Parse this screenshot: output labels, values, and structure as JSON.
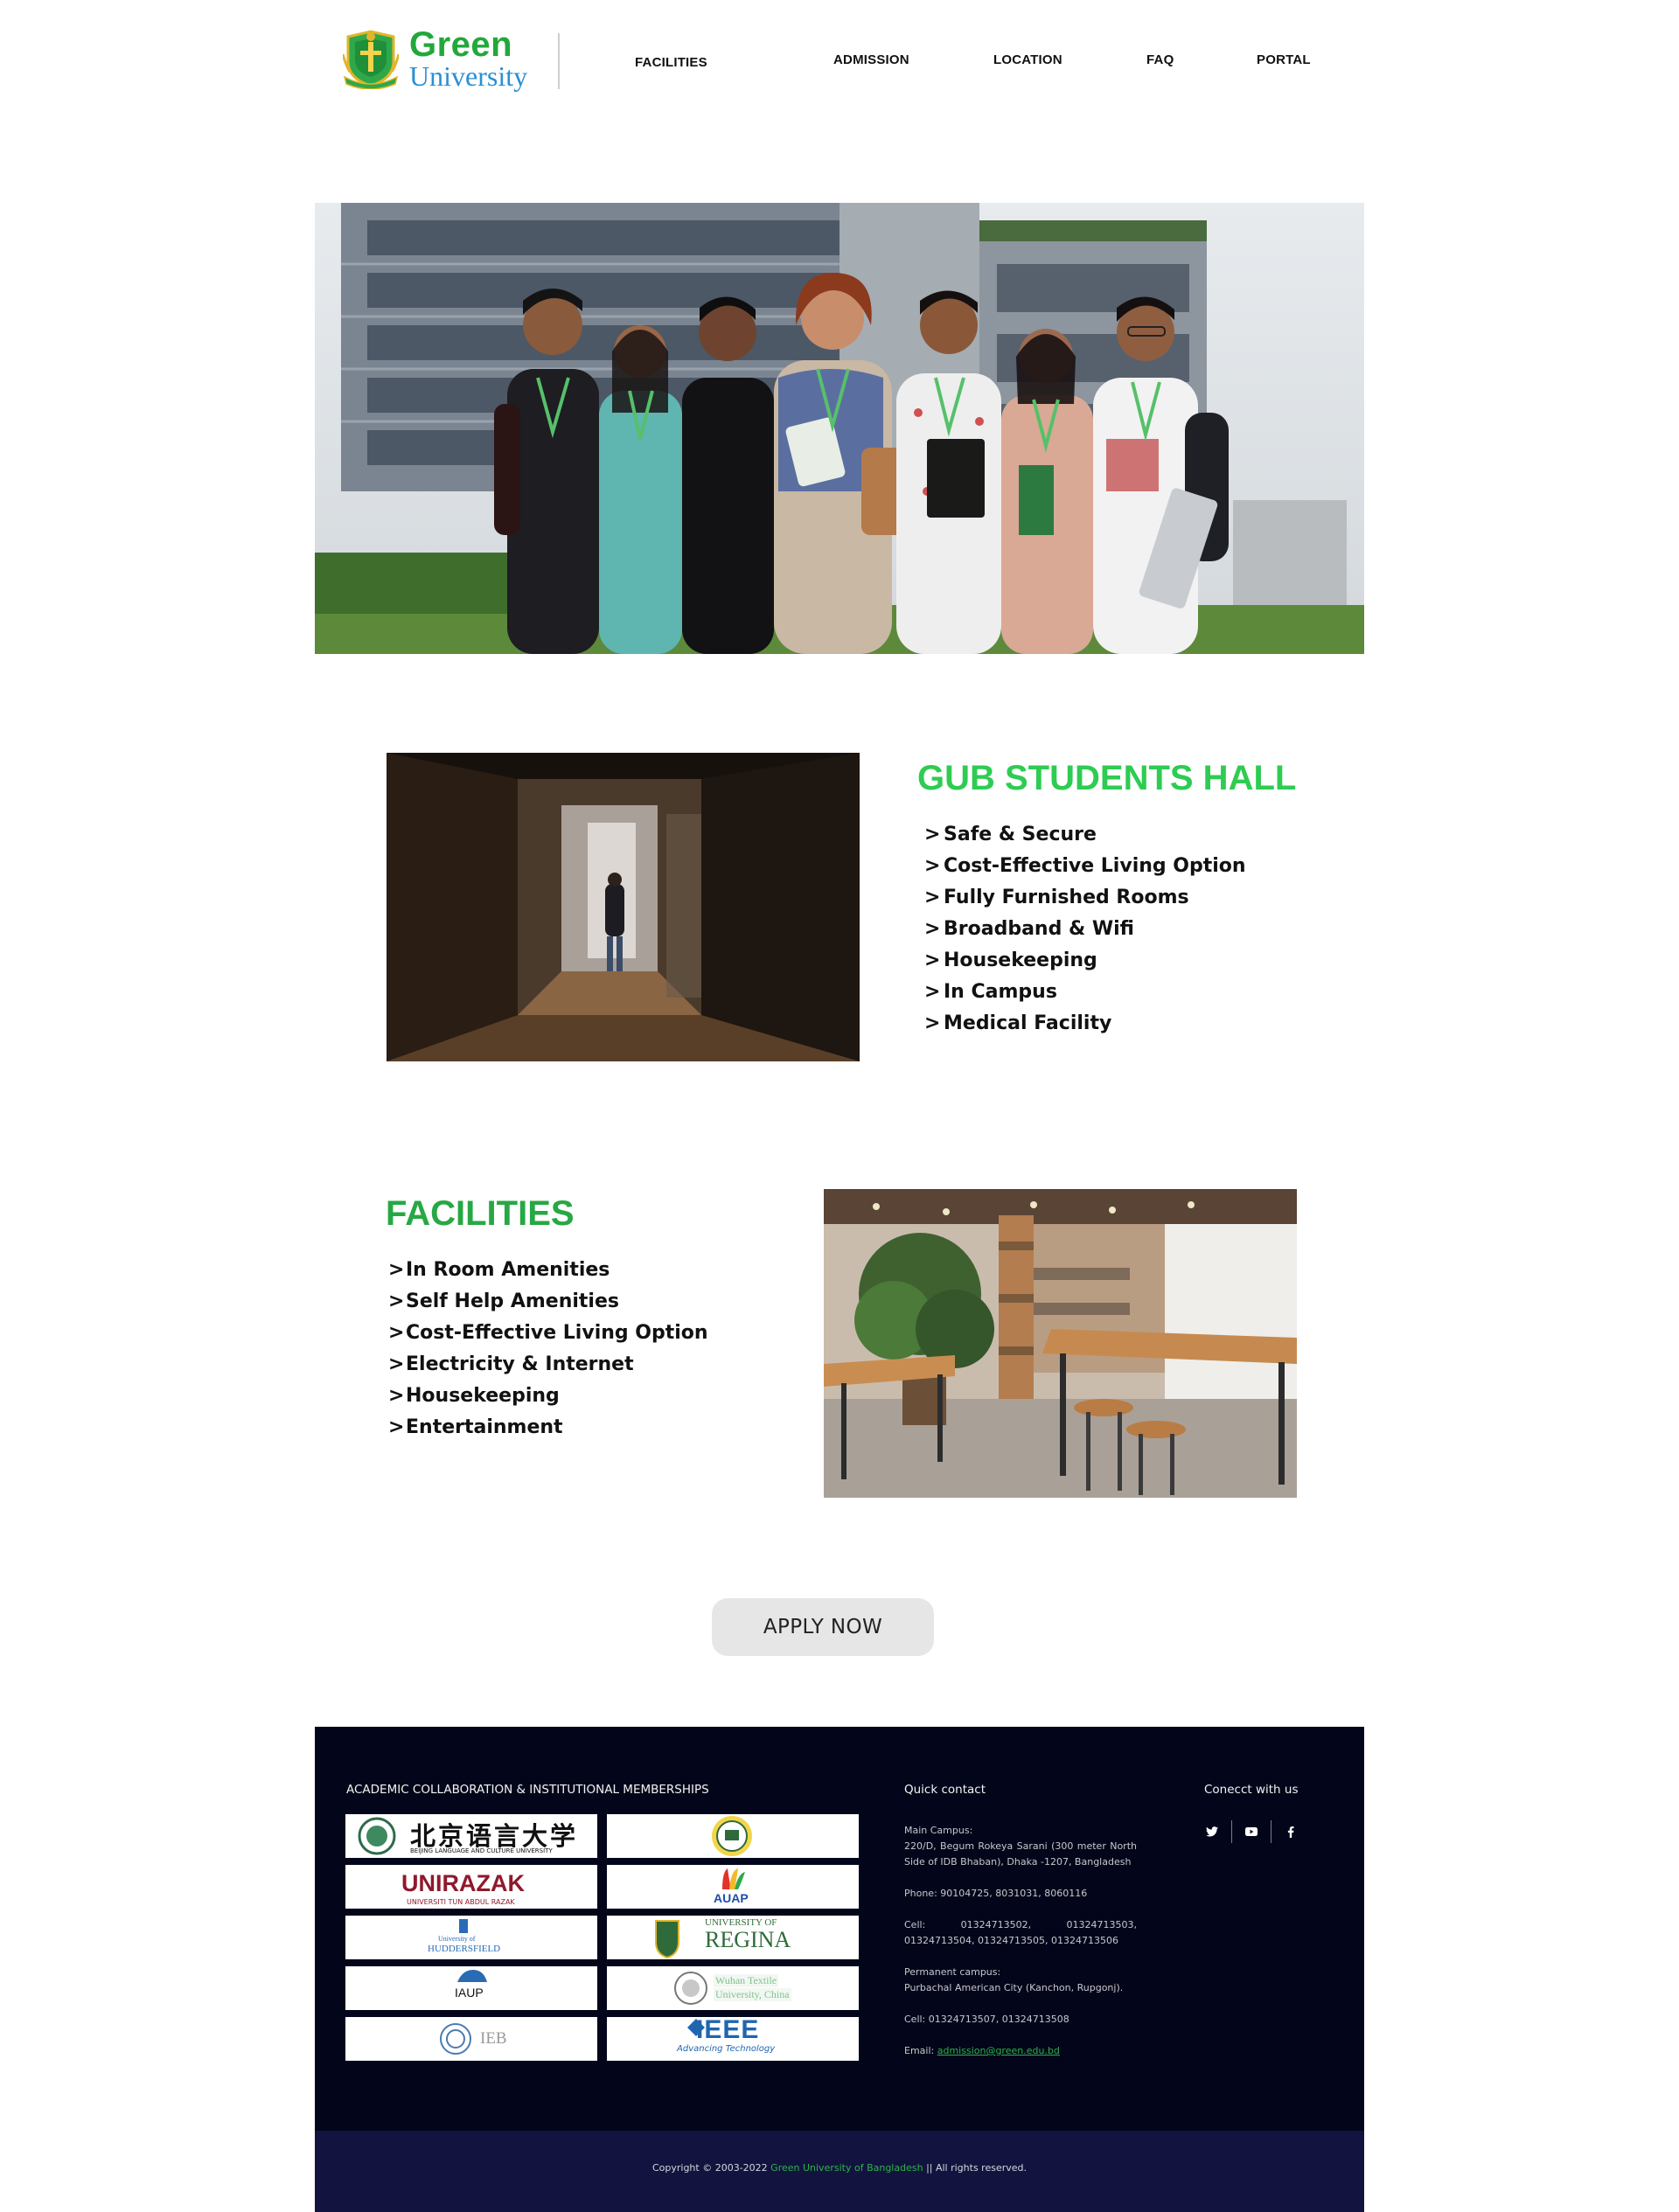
{
  "header": {
    "logo": {
      "name_line1": "Green",
      "name_line2": "University",
      "crest_text": "Green University"
    },
    "nav": [
      {
        "label": "FACILITIES"
      },
      {
        "label": "ADMISSION"
      },
      {
        "label": "LOCATION"
      },
      {
        "label": "FAQ"
      },
      {
        "label": "PORTAL"
      }
    ]
  },
  "hall": {
    "title": "GUB STUDENTS HALL",
    "title_color": "#2ecc52",
    "features": [
      {
        "chevron": ">",
        "label": "Safe & Secure"
      },
      {
        "chevron": ">",
        "label": "Cost-Effective Living Option"
      },
      {
        "chevron": ">",
        "label": "Fully Furnished Rooms"
      },
      {
        "chevron": ">",
        "label": "Broadband & Wifi"
      },
      {
        "chevron": ">",
        "label": "Housekeeping"
      },
      {
        "chevron": ">",
        "label": "In Campus"
      },
      {
        "chevron": ">",
        "label": "Medical Facility"
      }
    ]
  },
  "facilities": {
    "title": "FACILITIES",
    "title_color": "#27a844",
    "features": [
      {
        "chevron": ">",
        "label": "In Room Amenities"
      },
      {
        "chevron": ">",
        "label": "Self Help Amenities"
      },
      {
        "chevron": ">",
        "label": "Cost-Effective Living Option"
      },
      {
        "chevron": ">",
        "label": "Electricity & Internet"
      },
      {
        "chevron": ">",
        "label": "Housekeeping"
      },
      {
        "chevron": ">",
        "label": "Entertainment"
      }
    ]
  },
  "cta": {
    "apply_label": "APPLY NOW"
  },
  "footer": {
    "memberships_heading": "ACADEMIC COLLABORATION & INSTITUTIONAL MEMBERSHIPS",
    "logos": {
      "blcu": {
        "cn": "北京语言大学",
        "en": "BEIJING LANGUAGE AND CULTURE UNIVERSITY"
      },
      "unirazak": {
        "name": "UNIRAZAK",
        "sub": "UNIVERSITI TUN ABDUL RAZAK"
      },
      "auap": {
        "name": "AUAP"
      },
      "huddersfield": {
        "line1": "University of",
        "line2": "HUDDERSFIELD"
      },
      "regina": {
        "line1": "UNIVERSITY OF",
        "line2": "REGINA"
      },
      "iaup": {
        "name": "IAUP"
      },
      "wuhan": {
        "line1": "Wuhan Textile",
        "line2": "University, China"
      },
      "ieb": {
        "name": "IEB"
      },
      "ieee": {
        "name": "IEEE",
        "sub": "Advancing Technology"
      }
    },
    "quick_contact": {
      "heading": "Quick contact",
      "main_campus_label": "Main Campus:",
      "main_campus_address": "220/D, Begum Rokeya Sarani (300 meter North Side of IDB Bhaban), Dhaka -1207, Bangladesh",
      "phone": "Phone: 90104725, 8031031, 8060116",
      "cell": "Cell: 01324713502, 01324713503, 01324713504, 01324713505, 01324713506",
      "permanent_label": "Permanent campus:",
      "permanent_address": "Purbachal American City (Kanchon, Rupgonj).",
      "cell2": "Cell: 01324713507, 01324713508",
      "email_label": "Email:",
      "email": "admission@green.edu.bd"
    },
    "connect_heading": "Conecct with us",
    "social": [
      "twitter-icon",
      "youtube-icon",
      "facebook-icon"
    ],
    "copyright_prefix": "Copyright © 2003-2022",
    "copyright_org": "Green University of Bangladesh",
    "copyright_suffix": "|| All rights reserved."
  },
  "colors": {
    "brand_green": "#22a83a",
    "brand_blue": "#2a8fd4",
    "footer_bg": "#03061a",
    "footer_bottom_bg": "#12143f",
    "link_green": "#2fb14a",
    "button_bg": "#e6e6e6"
  }
}
